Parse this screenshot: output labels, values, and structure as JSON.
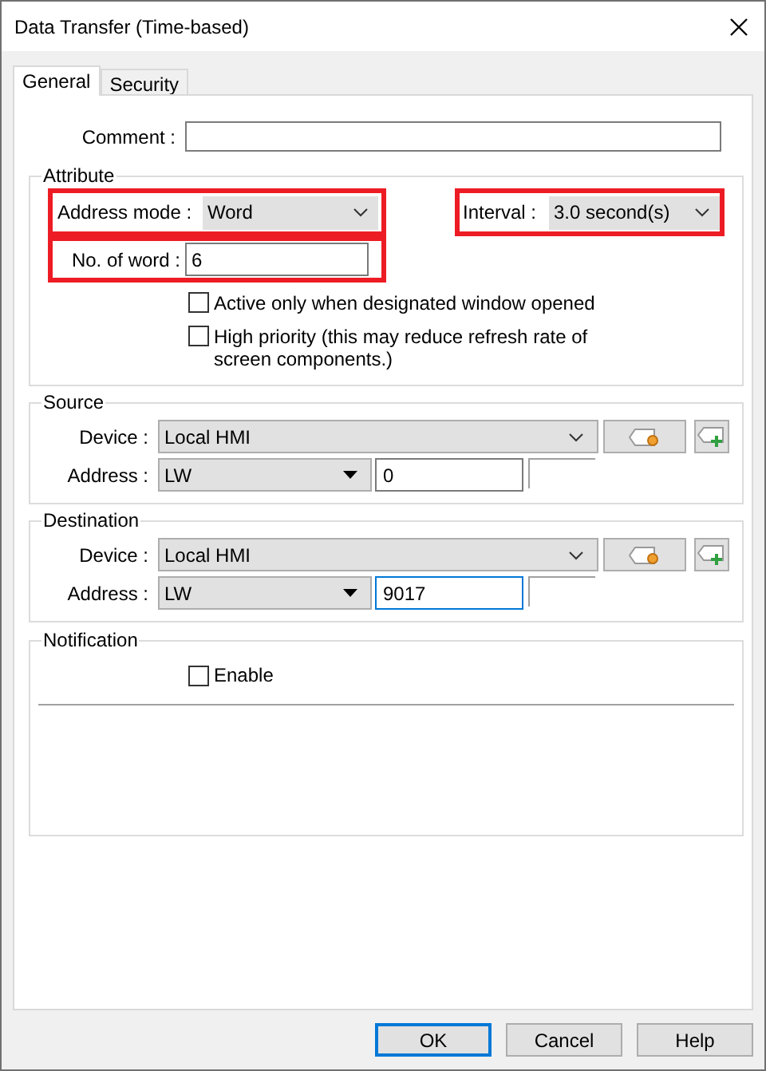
{
  "window": {
    "title": "Data Transfer (Time-based)"
  },
  "tabs": [
    {
      "label": "General",
      "selected": true
    },
    {
      "label": "Security",
      "selected": false
    }
  ],
  "comment": {
    "label": "Comment :"
  },
  "attribute": {
    "title": "Attribute",
    "address_mode": {
      "label": "Address mode :",
      "value": "Word",
      "highlighted": true
    },
    "interval": {
      "label": "Interval :",
      "value": "3.0 second(s)",
      "highlighted": true
    },
    "word_count": {
      "label": "No. of word :",
      "value": "6",
      "highlighted": true
    },
    "options": [
      {
        "label": "Active only when designated window opened",
        "checked": false
      },
      {
        "label": "High priority (this may reduce refresh rate of screen components.)",
        "checked": false
      }
    ]
  },
  "source": {
    "title": "Source",
    "device_label": "Device :",
    "device": "Local HMI",
    "address_label": "Address :",
    "address_type": "LW",
    "address": "0",
    "focused": false
  },
  "destination": {
    "title": "Destination",
    "device_label": "Device :",
    "device": "Local HMI",
    "address_label": "Address :",
    "address_type": "LW",
    "address": "9017",
    "focused": true
  },
  "notification": {
    "title": "Notification",
    "enable": {
      "label": "Enable",
      "checked": false
    }
  },
  "buttons": [
    {
      "label": "OK",
      "default": true
    },
    {
      "label": "Cancel",
      "default": false
    },
    {
      "label": "Help",
      "default": false
    }
  ]
}
